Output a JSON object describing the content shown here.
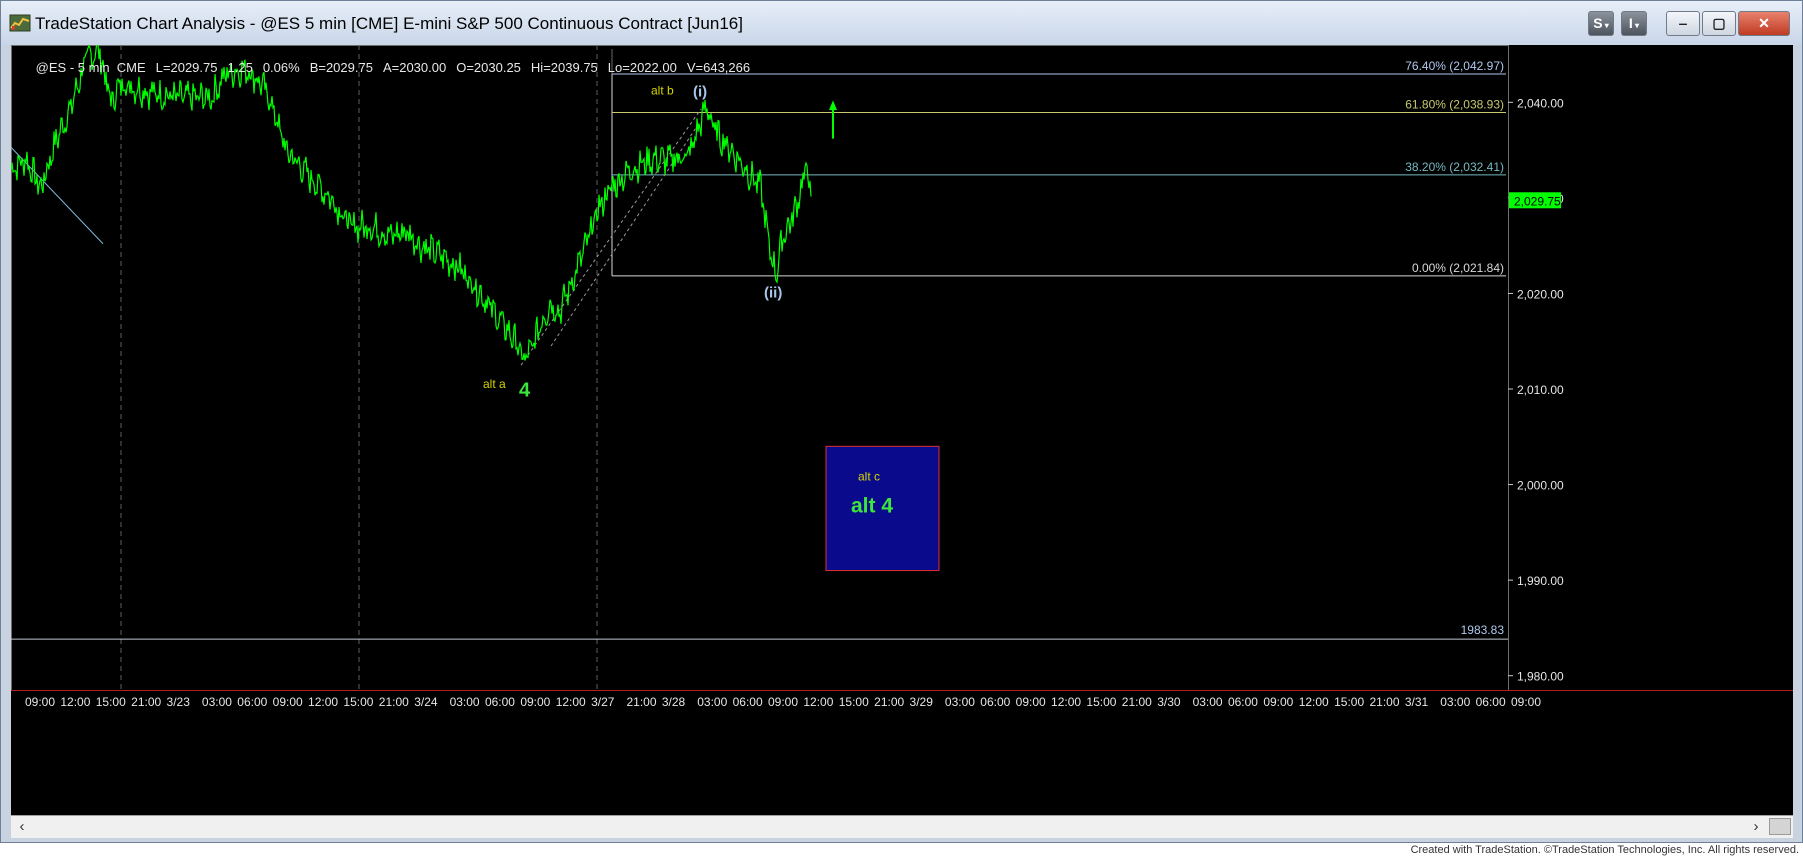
{
  "window": {
    "title": "TradeStation Chart Analysis - @ES 5 min [CME] E-mini S&P 500 Continuous Contract [Jun16]",
    "buttons": {
      "s": "S",
      "i": "I",
      "minimize": "‒",
      "restore": "▢",
      "close": "✕"
    }
  },
  "status": {
    "symbol": "@ES - 5 min  CME",
    "last": "L=2029.75",
    "change": "1.25",
    "pct": "0.06%",
    "bid": "B=2029.75",
    "ask": "A=2030.00",
    "open": "O=2030.25",
    "high": "Hi=2039.75",
    "low": "Lo=2022.00",
    "volume": "V=643,266"
  },
  "colors": {
    "background": "#000000",
    "price": "#00ff00",
    "wave_label": "#d6d600",
    "wave_major": "#3ce63c",
    "roman": "#a9c5ea",
    "fib_764": "#b0c8ee",
    "fib_618": "#c8c86e",
    "fib_382": "#76b8c2",
    "fib_0": "#d8d8d8",
    "target_box": "#0a0a8c",
    "target_border": "#e03030"
  },
  "price_axis": {
    "ticks": [
      {
        "value": 2040,
        "label": "2,040.00"
      },
      {
        "value": 2030,
        "label": "2,030.00"
      },
      {
        "value": 2020,
        "label": "2,020.00"
      },
      {
        "value": 2010,
        "label": "2,010.00"
      },
      {
        "value": 2000,
        "label": "2,000.00"
      },
      {
        "value": 1990,
        "label": "1,990.00"
      },
      {
        "value": 1980,
        "label": "1,980.00"
      }
    ],
    "last_price_label": "2,029.75",
    "last_price": 2029.75,
    "min": 1978.5,
    "max": 2046.0
  },
  "time_axis": {
    "labels": [
      "09:00",
      "12:00",
      "15:00",
      "21:00",
      "3/23",
      "03:00",
      "06:00",
      "09:00",
      "12:00",
      "15:00",
      "21:00",
      "3/24",
      "03:00",
      "06:00",
      "09:00",
      "12:00",
      "3/27",
      "21:00",
      "3/28",
      "03:00",
      "06:00",
      "09:00",
      "12:00",
      "15:00",
      "21:00",
      "3/29",
      "03:00",
      "06:00",
      "09:00",
      "12:00",
      "15:00",
      "21:00",
      "3/30",
      "03:00",
      "06:00",
      "09:00",
      "12:00",
      "15:00",
      "21:00",
      "3/31",
      "03:00",
      "06:00",
      "09:00"
    ]
  },
  "fib_levels": [
    {
      "label": "76.40% (2,042.97)",
      "price": 2042.97
    },
    {
      "label": "61.80% (2,038.93)",
      "price": 2038.93
    },
    {
      "label": "38.20% (2,032.41)",
      "price": 2032.41
    },
    {
      "label": "0.00% (2,021.84)",
      "price": 2021.84
    }
  ],
  "horizontal_line": {
    "label": "1983.83",
    "price": 1983.83
  },
  "annotations": {
    "alt_a": "alt a",
    "wave_4": "4",
    "alt_b": "alt b",
    "wave_i": "(i)",
    "wave_ii": "(ii)",
    "alt_c": "alt c",
    "alt_4": "alt 4"
  },
  "target_zone": {
    "top": 2004.0,
    "bottom": 1991.0
  },
  "footer": "Created with TradeStation. ©TradeStation Technologies, Inc. All rights reserved."
}
